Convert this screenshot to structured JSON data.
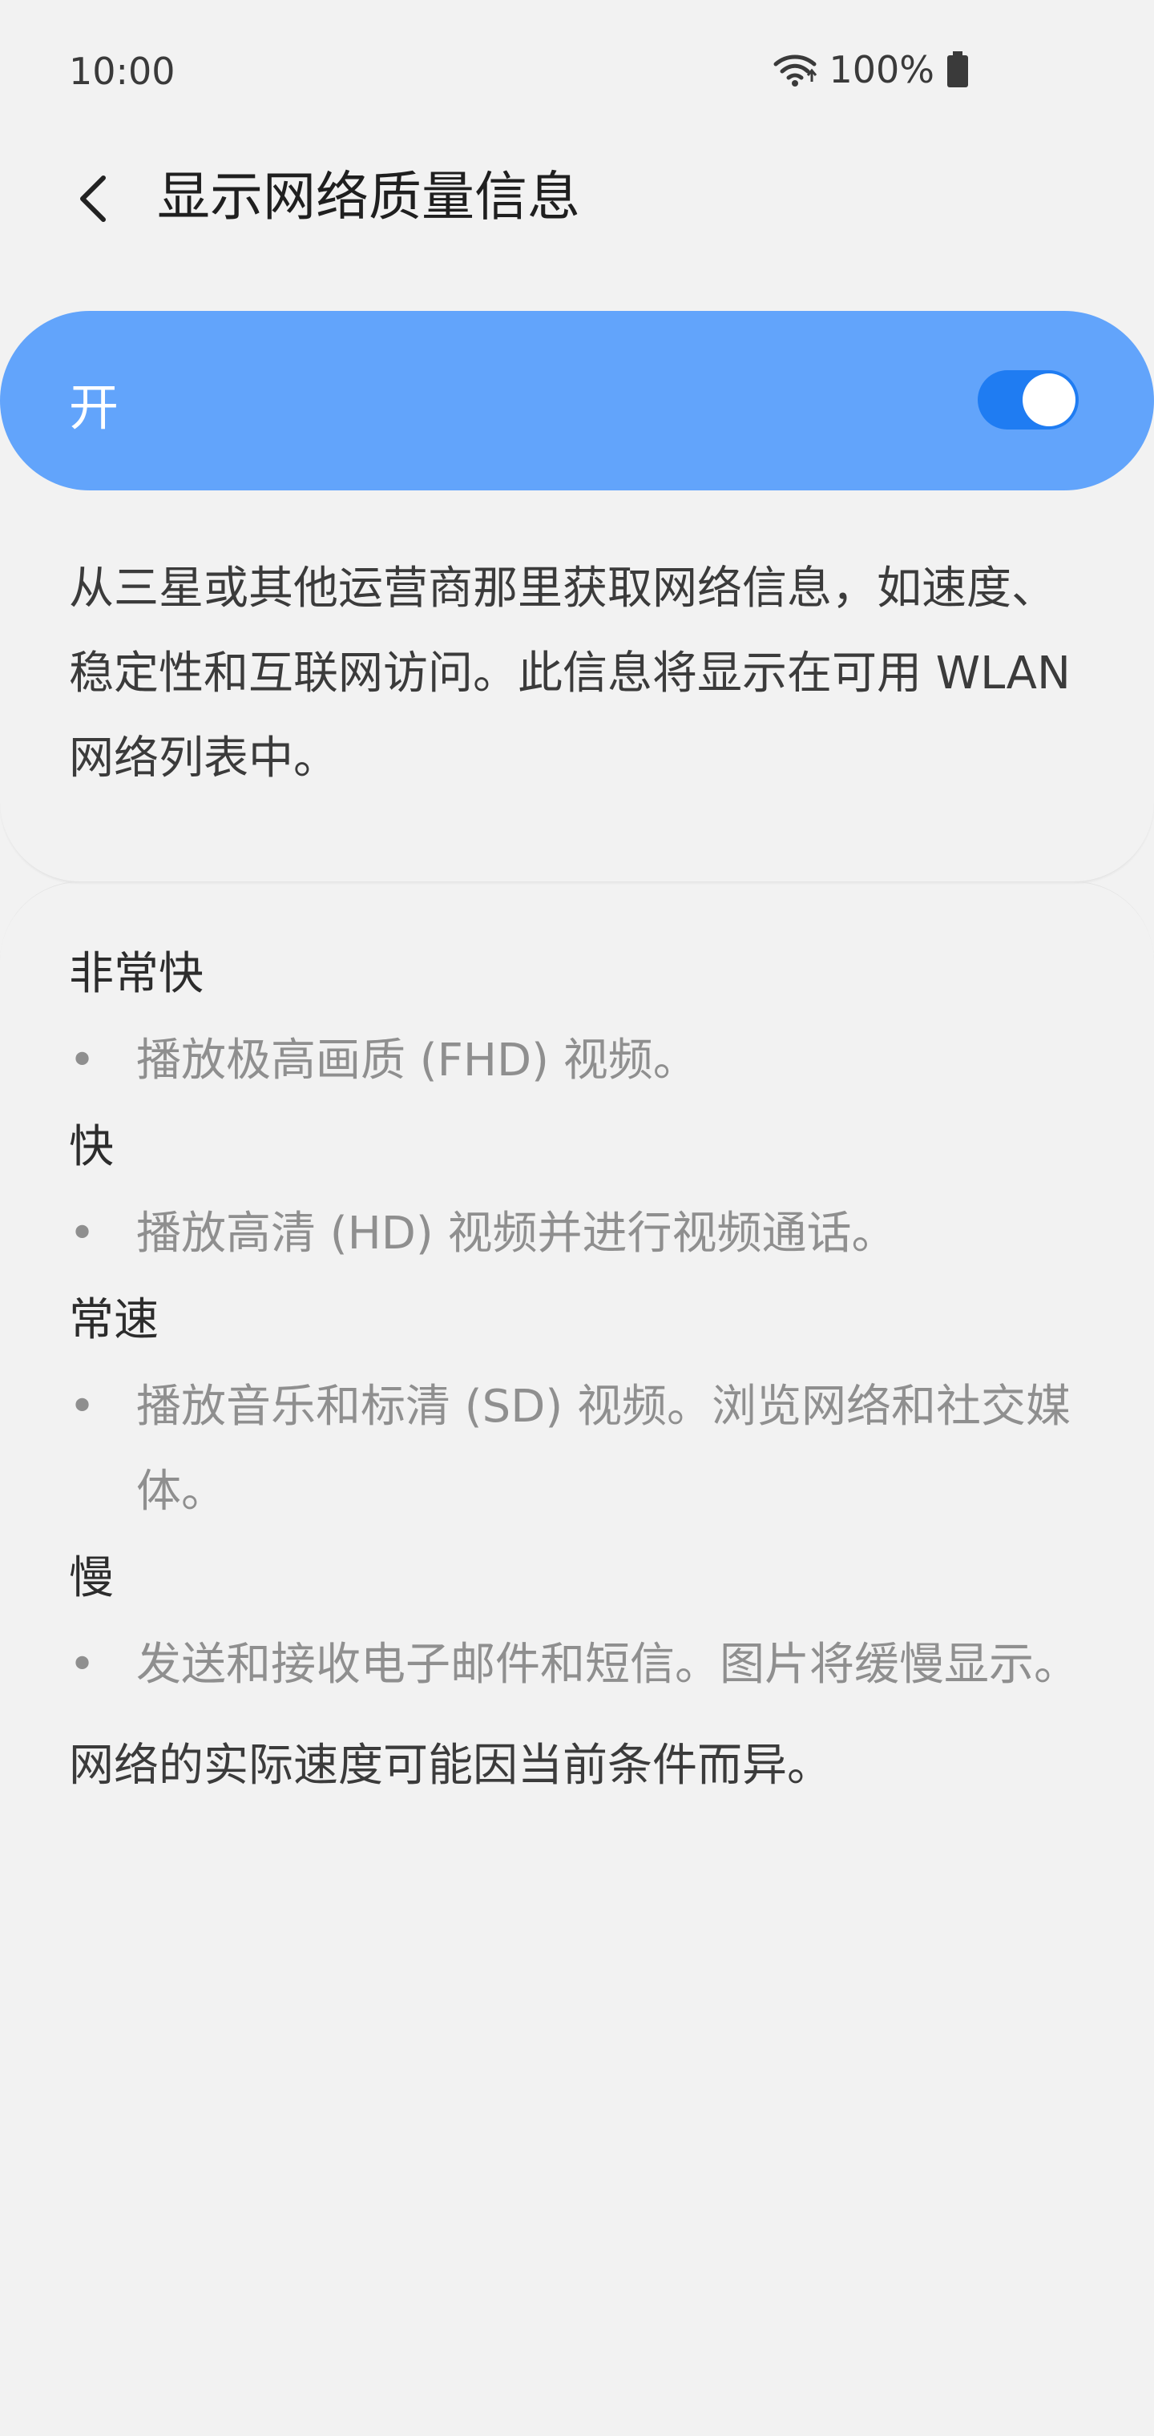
{
  "status_bar": {
    "time": "10:00",
    "battery": "100%",
    "icons": [
      "wifi-icon",
      "battery-icon"
    ]
  },
  "header": {
    "title": "显示网络质量信息",
    "back_icon": "chevron-left-icon"
  },
  "switch": {
    "label": "开",
    "state": "on",
    "accent_color": "#62a4fb",
    "toggle_color": "#1f7cf2"
  },
  "description": "从三星或其他运营商那里获取网络信息，如速度、稳定性和互联网访问。此信息将显示在可用 WLAN 网络列表中。",
  "levels": [
    {
      "title": "非常快",
      "detail": "播放极高画质 (FHD) 视频。"
    },
    {
      "title": "快",
      "detail": "播放高清 (HD) 视频并进行视频通话。"
    },
    {
      "title": "常速",
      "detail": "播放音乐和标清 (SD) 视频。浏览网络和社交媒体。"
    },
    {
      "title": "慢",
      "detail": "发送和接收电子邮件和短信。图片将缓慢显示。"
    }
  ],
  "footnote": "网络的实际速度可能因当前条件而异。"
}
